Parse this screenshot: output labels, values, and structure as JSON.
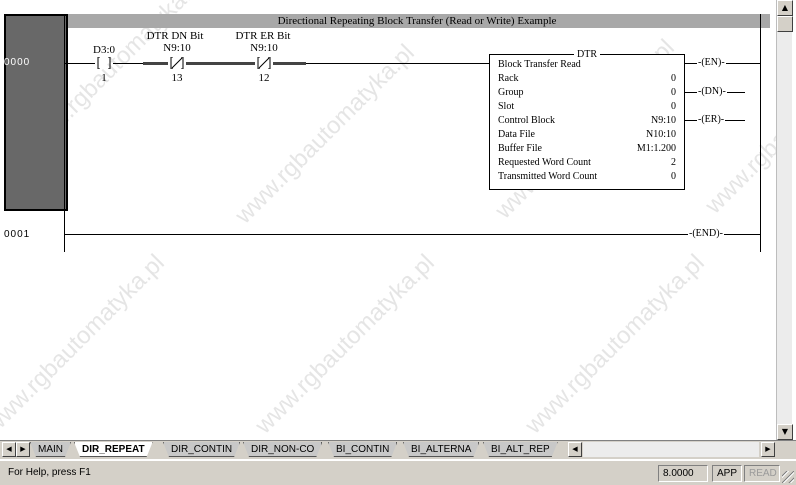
{
  "rung_title": "Directional Repeating Block Transfer (Read or Write) Example",
  "rungs": [
    {
      "number": "0000"
    },
    {
      "number": "0001"
    }
  ],
  "contacts": [
    {
      "desc1": "",
      "desc2": "",
      "address": "D3:0",
      "bit": "1",
      "type": "XIC"
    },
    {
      "desc1": "DTR DN Bit",
      "desc2": "",
      "address": "N9:10",
      "bit": "13",
      "type": "XIO"
    },
    {
      "desc1": "DTR ER Bit",
      "desc2": "",
      "address": "N9:10",
      "bit": "12",
      "type": "XIO"
    }
  ],
  "instruction": {
    "name": "DTR",
    "title": "Block Transfer Read",
    "rows": [
      {
        "label": "Rack",
        "value": "0"
      },
      {
        "label": "Group",
        "value": "0"
      },
      {
        "label": "Slot",
        "value": "0"
      },
      {
        "label": "Control Block",
        "value": "N9:10"
      },
      {
        "label": "Data File",
        "value": "N10:10"
      },
      {
        "label": "Buffer File",
        "value": "M1:1.200"
      },
      {
        "label": "Requested Word Count",
        "value": "2"
      },
      {
        "label": "Transmitted Word Count",
        "value": "0"
      }
    ]
  },
  "coils": [
    "EN",
    "DN",
    "ER"
  ],
  "end_coil": "END",
  "tabs": [
    "MAIN",
    "DIR_REPEAT",
    "DIR_CONTIN",
    "DIR_NON-CO",
    "BI_CONTIN",
    "BI_ALTERNA",
    "BI_ALT_REP"
  ],
  "active_tab": "DIR_REPEAT",
  "status": {
    "help_text": "For Help, press F1",
    "version": "8.0000",
    "mode": "APP",
    "access": "READ"
  },
  "watermark_text": "www.rgbautomatyka.pl",
  "icons": {
    "scroll_up": "▲",
    "scroll_down": "▼",
    "scroll_left": "◀",
    "scroll_right": "▶",
    "tab_prev": "◀",
    "tab_next": "▶"
  }
}
